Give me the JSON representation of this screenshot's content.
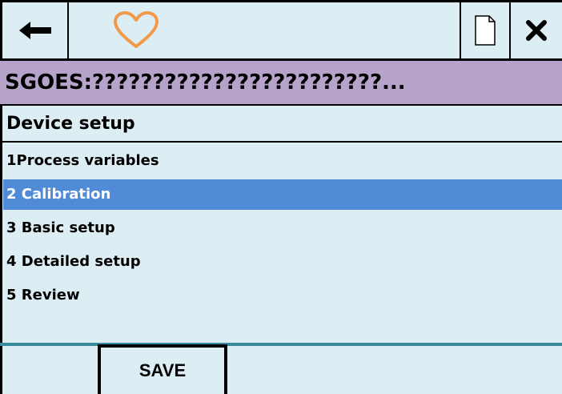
{
  "toolbar": {
    "back_icon": "arrow-left-icon",
    "favorite_icon": "heart-icon",
    "favorite_color": "#f29a4a",
    "document_icon": "document-icon",
    "close_icon": "close-icon"
  },
  "app_title": "SGOES:????????????????????????...",
  "section_title": "Device setup",
  "menu": {
    "items": [
      {
        "label": "1Process variables",
        "selected": false
      },
      {
        "label": "2 Calibration",
        "selected": true
      },
      {
        "label": "3 Basic setup",
        "selected": false
      },
      {
        "label": "4 Detailed setup",
        "selected": false
      },
      {
        "label": "5 Review",
        "selected": false
      }
    ]
  },
  "footer": {
    "save_label": "SAVE"
  },
  "colors": {
    "background": "#dcedf3",
    "title_bar": "#b5a3c9",
    "selection": "#518bd8",
    "divider": "#3a8a9e"
  }
}
